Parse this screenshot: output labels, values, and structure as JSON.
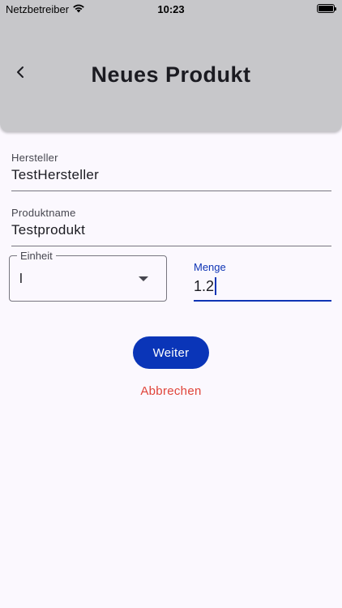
{
  "status_bar": {
    "carrier": "Netzbetreiber",
    "time": "10:23",
    "wifi_icon": "wifi-icon",
    "battery_icon": "battery-icon"
  },
  "header": {
    "title": "Neues Produkt",
    "back_icon": "chevron-left-icon",
    "background_color": "#C7C7CA"
  },
  "form": {
    "hersteller": {
      "label": "Hersteller",
      "value": "TestHersteller"
    },
    "produktname": {
      "label": "Produktname",
      "value": "Testprodukt"
    },
    "einheit": {
      "label": "Einheit",
      "selected": "l",
      "arrow_icon": "dropdown-arrow-icon"
    },
    "menge": {
      "label": "Menge",
      "value": "1.2",
      "focused": true
    }
  },
  "actions": {
    "next_label": "Weiter",
    "cancel_label": "Abbrechen"
  },
  "colors": {
    "accent": "#0A35B8",
    "danger": "#E0443A",
    "background": "#FBF8FE"
  }
}
